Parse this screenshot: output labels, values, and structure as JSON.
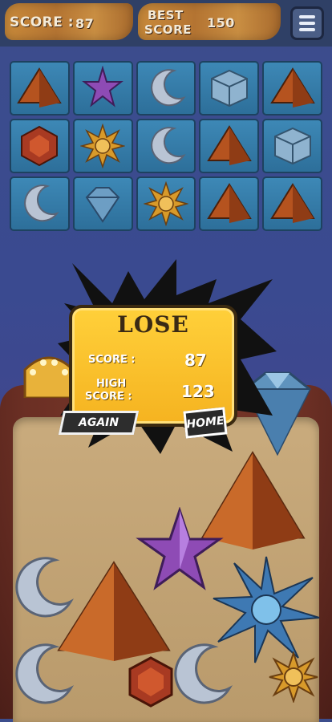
{
  "hud": {
    "score_label": "SCORE :",
    "score_value": "87",
    "best_label_line1": "BEST",
    "best_label_line2": "SCORE",
    "best_value": "150",
    "menu_icon": "hamburger-menu-icon"
  },
  "board": {
    "rows": [
      [
        "pyramid",
        "star",
        "moon",
        "cube",
        "pyramid"
      ],
      [
        "hexagon",
        "sun",
        "moon",
        "pyramid",
        "cube"
      ],
      [
        "moon",
        "diamond",
        "sun",
        "pyramid",
        "pyramid"
      ]
    ]
  },
  "dialog": {
    "title": "LOSE",
    "score_label": "SCORE :",
    "score_value": "87",
    "high_label_line1": "HIGH",
    "high_label_line2": "SCORE :",
    "high_value": "123",
    "again_label": "AGAIN",
    "home_label": "HOME"
  },
  "colors": {
    "pyramid": "#b5531f",
    "star": "#8e4bb5",
    "moon": "#b9c4d4",
    "cube": "#8fb3cf",
    "hexagon": "#a83a22",
    "sun": "#d89a2a",
    "diamond": "#6d9ec4",
    "dialog_fill": "#fcc22d"
  }
}
